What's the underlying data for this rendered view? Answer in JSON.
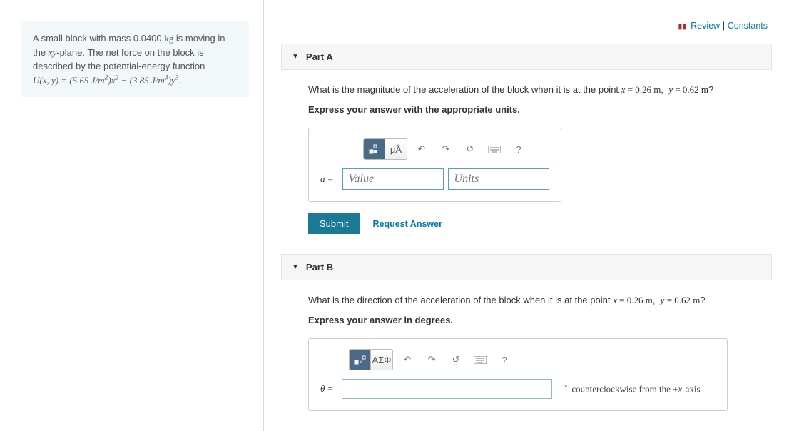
{
  "header": {
    "review": "Review",
    "constants": "Constants",
    "separator": " | "
  },
  "problem": {
    "text_pre": "A small block with mass 0.0400 ",
    "unit_kg": "kg",
    "text_mid1": " is moving in the ",
    "xy": "xy",
    "text_mid2": "-plane. The net force on the block is described by the potential-energy function ",
    "func_html": "U(x, y) = (5.65 J/m²)x² − (3.85 J/m³)y³."
  },
  "partA": {
    "title": "Part A",
    "question": "What is the magnitude of the acceleration of the block when it is at the point x = 0.26 m,  y = 0.62 m?",
    "instruction": "Express your answer with the appropriate units.",
    "lhs": "a =",
    "value_placeholder": "Value",
    "units_placeholder": "Units",
    "submit": "Submit",
    "request": "Request Answer",
    "tool_units": "μÅ",
    "tool_help": "?"
  },
  "partB": {
    "title": "Part B",
    "question": "What is the direction of the acceleration of the block when it is at the point x = 0.26 m,  y = 0.62 m?",
    "instruction": "Express your answer in degrees.",
    "lhs": "θ =",
    "post_text": "counterclockwise from the +x-axis",
    "tool_greek": "ΑΣΦ",
    "tool_help": "?"
  }
}
